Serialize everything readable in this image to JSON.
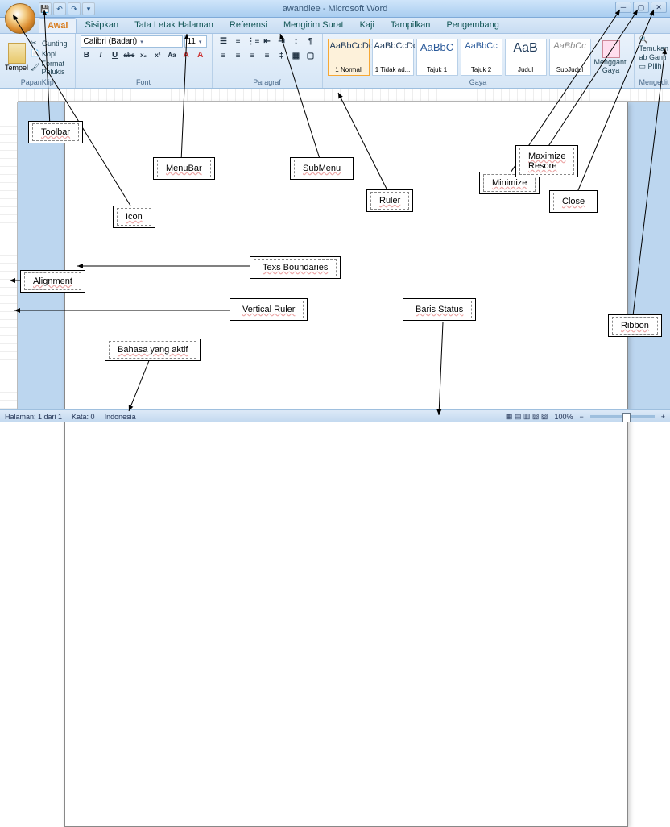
{
  "title": "awandiee - Microsoft Word",
  "qat": [
    "💾",
    "↶",
    "↷",
    "▾"
  ],
  "tabs": [
    "Awal",
    "Sisipkan",
    "Tata Letak Halaman",
    "Referensi",
    "Mengirim Surat",
    "Kaji",
    "Tampilkan",
    "Pengembang"
  ],
  "ribbon": {
    "clipboard": {
      "paste": "Tempel",
      "cut": "Gunting",
      "copy": "Kopi",
      "fmt": "Format Pelukis",
      "label": "PapanKlip"
    },
    "font": {
      "name": "Calibri (Badan)",
      "size": "11",
      "label": "Font",
      "buttons": [
        "B",
        "I",
        "U",
        "abc",
        "x₂",
        "x²",
        "Aa",
        "A",
        "A"
      ]
    },
    "para": {
      "label": "Paragraf"
    },
    "styles": {
      "label": "Gaya",
      "items": [
        {
          "sample": "AaBbCcDc",
          "name": "1 Normal"
        },
        {
          "sample": "AaBbCcDc",
          "name": "1 Tidak ad..."
        },
        {
          "sample": "AaBbC",
          "name": "Tajuk 1"
        },
        {
          "sample": "AaBbCc",
          "name": "Tajuk 2"
        },
        {
          "sample": "AaB",
          "name": "Judul"
        },
        {
          "sample": "AaBbCc",
          "name": "SubJudul"
        }
      ],
      "change": "Mengganti Gaya"
    },
    "editing": {
      "find": "Temukan",
      "replace": "Ganti",
      "select": "Pilih",
      "label": "Mengedit"
    }
  },
  "status": {
    "page": "Halaman: 1 dari 1",
    "words": "Kata: 0",
    "lang": "Indonesia",
    "zoom": "100%"
  },
  "callouts": {
    "toolbar": "Toolbar",
    "icon": "Icon",
    "menubar": "MenuBar",
    "submenu": "SubMenu",
    "ruler": "Ruler",
    "minimize": "Minimize",
    "maxres": "Maximize\nResore",
    "close": "Close",
    "alignment": "Alignment",
    "texs": "Texs Boundaries",
    "vruler": "Vertical Ruler",
    "baris": "Baris Status",
    "bahasa": "Bahasa yang aktif",
    "ribbon": "Ribbon"
  }
}
